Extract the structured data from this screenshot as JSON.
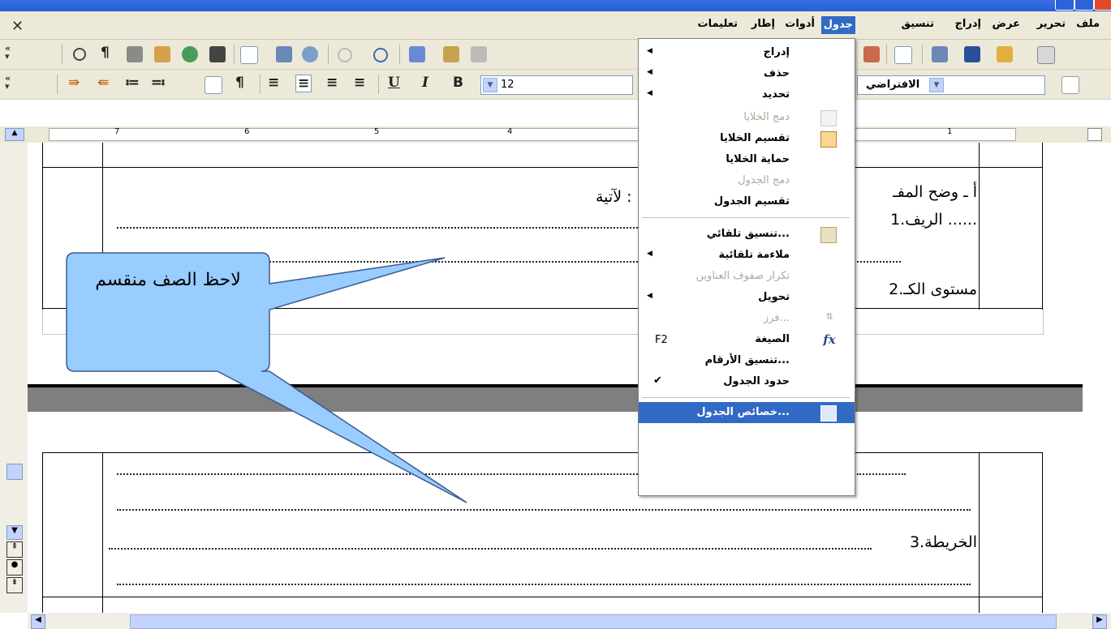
{
  "menubar": {
    "items": [
      "ملف",
      "تحرير",
      "عرض",
      "إدراج",
      "تنسيق",
      "جدول",
      "أدوات",
      "إطار",
      "تعليمات"
    ]
  },
  "toolbar": {
    "font_size": "12",
    "paragraph_style": "الافتراضي"
  },
  "ruler": {
    "marks": [
      "7",
      "6",
      "5",
      "4",
      "1"
    ]
  },
  "document": {
    "line_a": "أ ـ وضح المفـ",
    "line_a_tail": "لآتية :",
    "item_1": "1.الريف ......",
    "item_2": "2.مستوى الكـ",
    "item_3": "3.الخريطة",
    "callout_text": "لاحظ الصف منقسم"
  },
  "table_menu": {
    "items": [
      {
        "label": "إدراج",
        "submenu": true,
        "enabled": true
      },
      {
        "label": "حذف",
        "submenu": true,
        "enabled": true
      },
      {
        "label": "تحديد",
        "submenu": true,
        "enabled": true
      },
      {
        "label": "دمج الخلايا",
        "enabled": false,
        "icon": "merge-cells-icon"
      },
      {
        "label": "تقسيم الخلايا",
        "enabled": true,
        "icon": "split-cells-icon"
      },
      {
        "label": "حماية الخلايا",
        "enabled": true
      },
      {
        "label": "دمج الجدول",
        "enabled": false
      },
      {
        "label": "تقسيم الجدول",
        "enabled": true
      },
      {
        "label": "تنسيق تلقائي...",
        "enabled": true,
        "icon": "autoformat-icon"
      },
      {
        "label": "ملاءمة تلقائية",
        "submenu": true,
        "enabled": true
      },
      {
        "label": "تكرار صفوف العناوين",
        "enabled": false
      },
      {
        "label": "تحويل",
        "submenu": true,
        "enabled": true
      },
      {
        "label": "فرز...",
        "enabled": false,
        "icon": "sort-icon"
      },
      {
        "label": "الصيغة",
        "shortcut": "F2",
        "enabled": true,
        "icon": "formula-icon"
      },
      {
        "label": "تنسيق الأرقام...",
        "enabled": true
      },
      {
        "label": "حدود الجدول",
        "enabled": true,
        "checked": true
      },
      {
        "label": "خصائص الجدول...",
        "enabled": true,
        "highlighted": true,
        "icon": "table-properties-icon"
      }
    ]
  },
  "colors": {
    "menu_highlight": "#316ac5",
    "callout_fill": "#99ccff",
    "toolbar_bg": "#ece9d8"
  }
}
